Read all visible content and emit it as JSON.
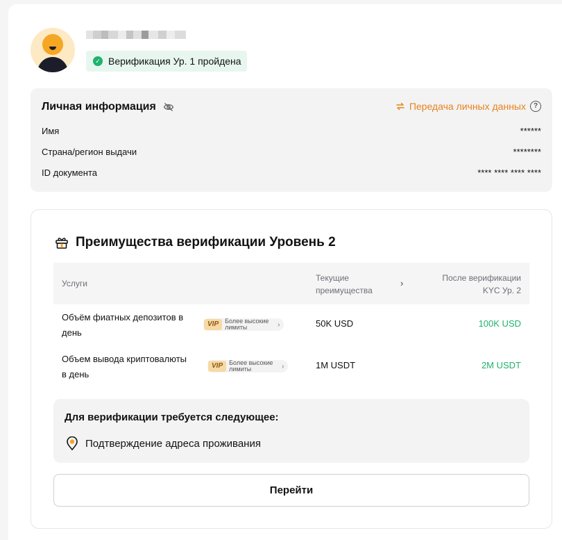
{
  "profile": {
    "verification_badge": "Верификация Ур. 1 пройдена"
  },
  "personal_info": {
    "title": "Личная информация",
    "transfer_link": "Передача личных данных",
    "rows": [
      {
        "label": "Имя",
        "value": "******"
      },
      {
        "label": "Страна/регион выдачи",
        "value": "********"
      },
      {
        "label": "ID документа",
        "value": "**** **** **** ****"
      }
    ]
  },
  "benefits": {
    "title": "Преимущества верификации Уровень 2",
    "table": {
      "col_services": "Услуги",
      "col_current_line1": "Текущие",
      "col_current_line2": "преимущества",
      "col_after_line1": "После верификации",
      "col_after_line2": "KYC Ур. 2",
      "rows": [
        {
          "service_line1": "Объём фиатных депозитов в",
          "service_line2": "день",
          "vip_tag": "VIP",
          "vip_text": "Более высокие лимиты",
          "current": "50K USD",
          "after": "100K USD"
        },
        {
          "service_line1": "Объем вывода криптовалюты",
          "service_line2": "в день",
          "vip_tag": "VIP",
          "vip_text": "Более высокие лимиты",
          "current": "1M USDT",
          "after": "2M USDT"
        }
      ]
    },
    "requirements": {
      "title": "Для верификации требуется следующее:",
      "items": [
        "Подтверждение адреса проживания"
      ]
    },
    "go_button": "Перейти"
  },
  "colors": {
    "accent_orange": "#e8821a",
    "success_green": "#20b26c",
    "vip_gold": "#f7d9a6"
  }
}
